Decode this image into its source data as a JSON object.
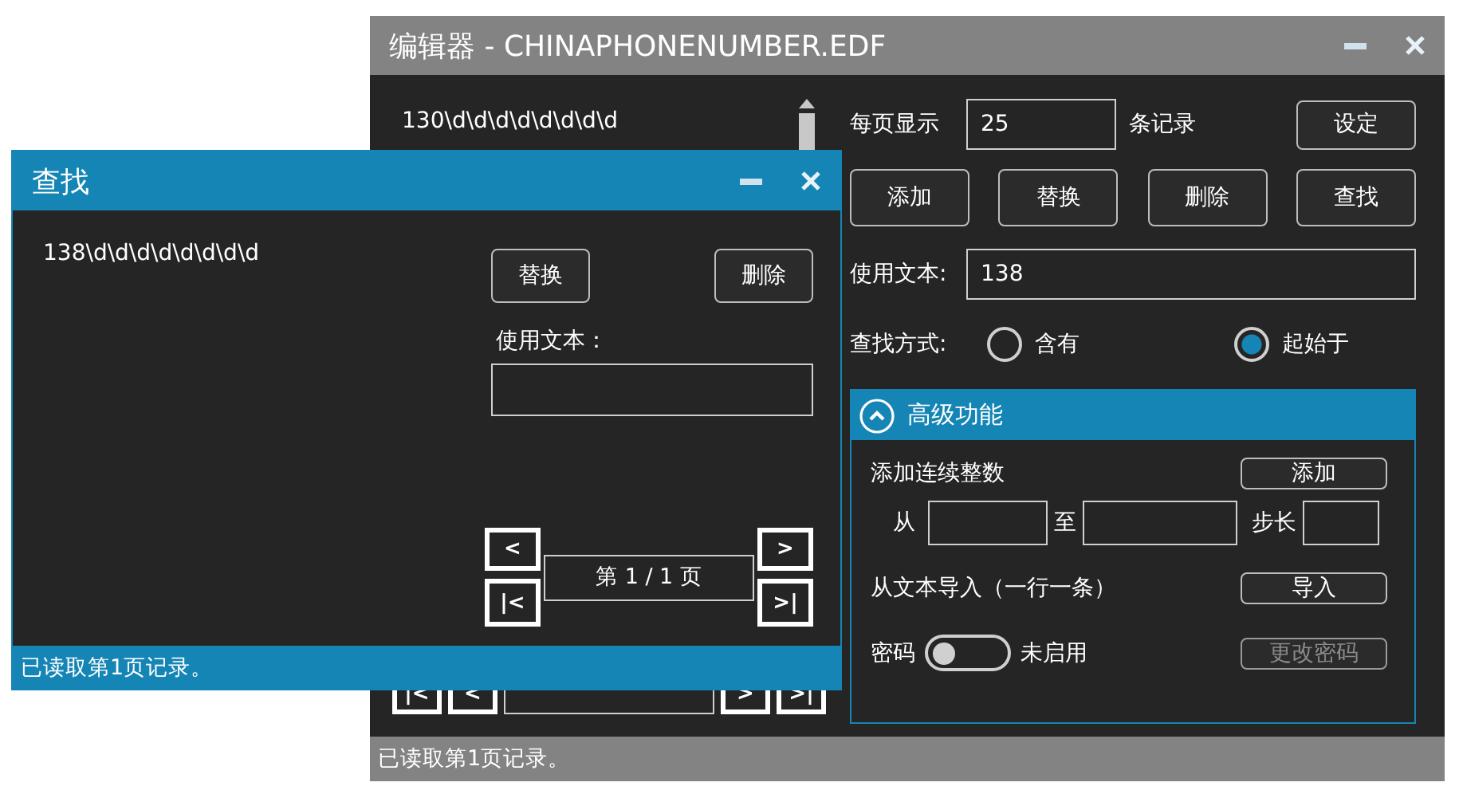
{
  "main_window": {
    "title": "编辑器 - CHINAPHONENUMBER.EDF",
    "list_items": [
      "130\\d\\d\\d\\d\\d\\d\\d\\d"
    ],
    "page_size": {
      "label": "每页显示",
      "value": "25",
      "suffix": "条记录",
      "button": "设定"
    },
    "actions": [
      "添加",
      "替换",
      "删除",
      "查找"
    ],
    "use_text": {
      "label": "使用文本:",
      "value": "138"
    },
    "search_mode": {
      "label": "查找方式:",
      "options": [
        {
          "label": "含有",
          "selected": false
        },
        {
          "label": "起始于",
          "selected": true
        }
      ]
    },
    "advanced": {
      "title": "高级功能",
      "expanded": true,
      "add_range": {
        "label": "添加连续整数",
        "button": "添加",
        "from_label": "从",
        "to_label": "至",
        "step_label": "步长"
      },
      "import": {
        "label": "从文本导入（一行一条）",
        "button": "导入"
      },
      "password": {
        "label": "密码",
        "on": false,
        "state_text": "未启用",
        "button": {
          "label": "更改密码",
          "disabled": true
        }
      }
    },
    "pager": {
      "first": "|<",
      "prev": "<",
      "next": ">",
      "last": ">|"
    },
    "status_bar": "已读取第1页记录。"
  },
  "find_window": {
    "title": "查找",
    "list_items": [
      "138\\d\\d\\d\\d\\d\\d\\d\\d"
    ],
    "actions": [
      "替换",
      "删除"
    ],
    "use_text": {
      "label": "使用文本："
    },
    "pager": {
      "first": "|<",
      "prev": "<",
      "page": "第 1 / 1 页",
      "next": ">",
      "last": ">|"
    },
    "status_bar": "已读取第1页记录。"
  }
}
